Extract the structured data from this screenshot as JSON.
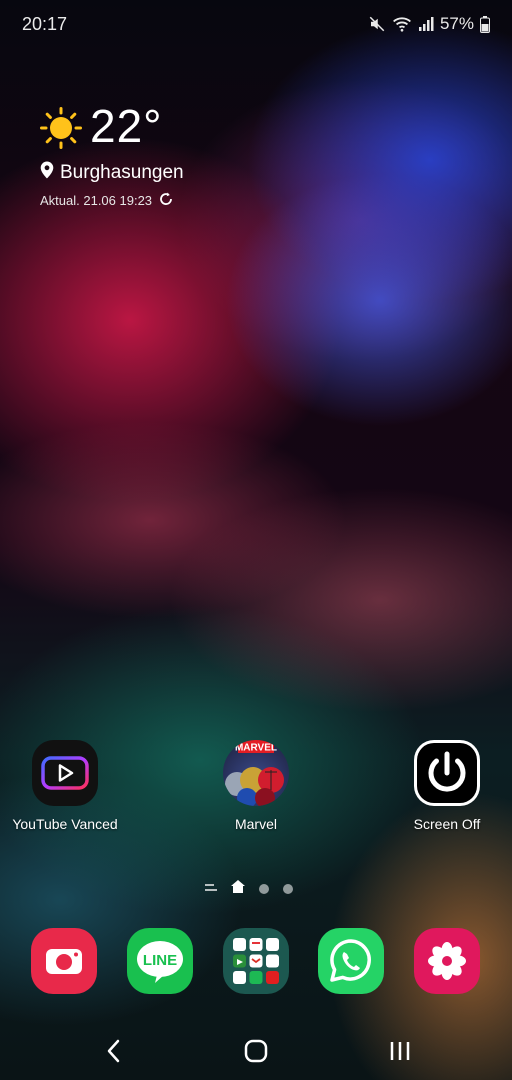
{
  "status_bar": {
    "time": "20:17",
    "battery_percent": "57%",
    "icons": [
      "mute-icon",
      "wifi-icon",
      "signal-icon",
      "battery-icon"
    ]
  },
  "weather": {
    "temperature": "22°",
    "location": "Burghasungen",
    "updated": "Aktual. 21.06 19:23",
    "icon": "sun-icon"
  },
  "apps": [
    {
      "label": "YouTube Vanced",
      "icon": "youtube-vanced-icon"
    },
    {
      "label": "Marvel",
      "icon": "marvel-icon",
      "badge": "MARVEL"
    },
    {
      "label": "Screen Off",
      "icon": "power-icon"
    }
  ],
  "page_indicator": {
    "pages": 3,
    "current": "home"
  },
  "dock": [
    {
      "name": "camera",
      "icon": "camera-icon",
      "color": "#e8294a"
    },
    {
      "name": "line",
      "icon": "line-icon",
      "text": "LINE",
      "color": "#19c04f"
    },
    {
      "name": "folder",
      "icon": "folder-icon",
      "color": "#1e5e55"
    },
    {
      "name": "whatsapp",
      "icon": "whatsapp-icon",
      "color": "#25d366"
    },
    {
      "name": "gallery",
      "icon": "flower-icon",
      "color": "#e0185d"
    }
  ],
  "navigation": [
    "back-icon",
    "home-icon",
    "recents-icon"
  ]
}
